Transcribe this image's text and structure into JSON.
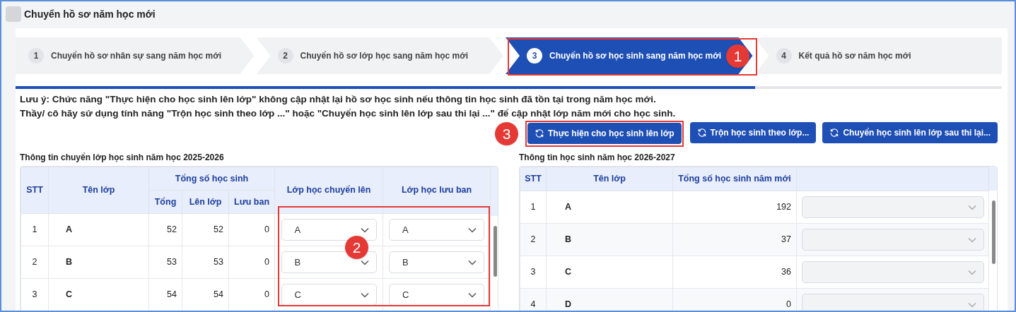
{
  "window": {
    "title": "Chuyển hồ sơ năm học mới"
  },
  "steps": [
    {
      "number": "1",
      "label": "Chuyển hồ sơ nhân sự sang năm học mới",
      "selected": false
    },
    {
      "number": "2",
      "label": "Chuyển hồ sơ lớp học sang năm học mới",
      "selected": false
    },
    {
      "number": "3",
      "label": "Chuyển hồ sơ học sinh sang năm học mới",
      "selected": true
    },
    {
      "number": "4",
      "label": "Kết quả hồ sơ năm học mới",
      "selected": false
    }
  ],
  "progress": {
    "level": 0.75
  },
  "notes": [
    "Lưu ý: Chức năng \"Thực hiện cho học sinh lên lớp\" không cập nhật lại hồ sơ học sinh nếu thông tin học sinh đã tồn tại trong năm học mới.",
    "Thầy/ cô hãy sử dụng tính năng \"Trộn học sinh theo lớp ...\" hoặc \"Chuyển học sinh lên lớp sau thi lại ...\" để cập nhật lớp năm mới cho học sinh."
  ],
  "buttons": [
    "Thực hiện cho học sinh lên lớp",
    "Trộn học sinh theo lớp...",
    "Chuyển học sinh lên lớp sau thi lại..."
  ],
  "left_table": {
    "caption": "Thông tin chuyển lớp học sinh năm học 2025-2026",
    "columns": {
      "stt": "STT",
      "class": "Tên lớp",
      "group": "Tổng số học sinh",
      "total": "Tổng",
      "promoted": "Lên lớp",
      "retained": "Lưu ban",
      "promote_to": "Lớp học chuyển lên",
      "retain_in": "Lớp học lưu ban"
    },
    "rows": [
      {
        "stt": "1",
        "class": "A",
        "total": "52",
        "promoted": "52",
        "retained": "0",
        "promote_to": "A",
        "retain_in": "A"
      },
      {
        "stt": "2",
        "class": "B",
        "total": "53",
        "promoted": "53",
        "retained": "0",
        "promote_to": "B",
        "retain_in": "B"
      },
      {
        "stt": "3",
        "class": "C",
        "total": "54",
        "promoted": "54",
        "retained": "0",
        "promote_to": "C",
        "retain_in": "C"
      }
    ]
  },
  "right_table": {
    "caption": "Thông tin học sinh năm học 2026-2027",
    "columns": [
      "STT",
      "Tên lớp",
      "Tổng số học sinh năm mới"
    ],
    "rows": [
      {
        "stt": "1",
        "class": "A",
        "total": "192",
        "disabled": true
      },
      {
        "stt": "2",
        "class": "B",
        "total": "37",
        "disabled": true
      },
      {
        "stt": "3",
        "class": "C",
        "total": "36",
        "disabled": true
      },
      {
        "stt": "4",
        "class": "D",
        "total": "0",
        "disabled": true
      }
    ]
  },
  "callouts": [
    {
      "label": "1"
    },
    {
      "label": "2"
    },
    {
      "label": "3"
    }
  ]
}
